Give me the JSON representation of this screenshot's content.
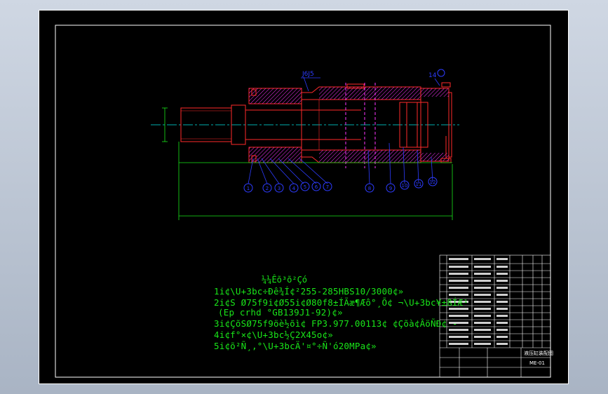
{
  "drawing": {
    "colors": {
      "sheet": "#000000",
      "frame": "#ffffff",
      "outline": "#ff2a2a",
      "hatch": "#ff33ff",
      "dimension": "#19e619",
      "center_line": "#00e5e5",
      "balloon": "#2d3cff",
      "note_text": "#19e619"
    },
    "callouts": {
      "top_label": "J6J5",
      "right_label": "14",
      "balloons": [
        "1",
        "2",
        "3",
        "4",
        "5",
        "6",
        "7",
        "8",
        "9",
        "10",
        "11",
        "12"
      ]
    },
    "tech_requirements": {
      "title": "¼¼Êõ³õ²Çó",
      "lines": [
        "1i¢\\U+3bc÷Ðê¾Í¢²255-285HBS10/3000¢»",
        "2i¢S Ø75f9i¢Ø55i¢Ø80f8±ÍÃæ¶Æô°¸Õ¢ ¬\\U+3bc¥±ßÍÆ¹",
        "(Ep crhd °GB139J1-92)¢»",
        "3i¢ÇõSØ75f9öè½õì¢ FP3.977.00113¢ ¢Çõà¢ÂöÑÐ¢ -",
        "4i¢f°×¢\\U+3bc½Ç2X45o¢»",
        "5i¢õ²Ñ¸,°\\U+3bcÄ'¤°÷Ñ'ó20MPa¢»"
      ]
    },
    "title_block": {
      "drawing_name": "液压缸装配图",
      "drawing_number": "ME-01"
    }
  }
}
